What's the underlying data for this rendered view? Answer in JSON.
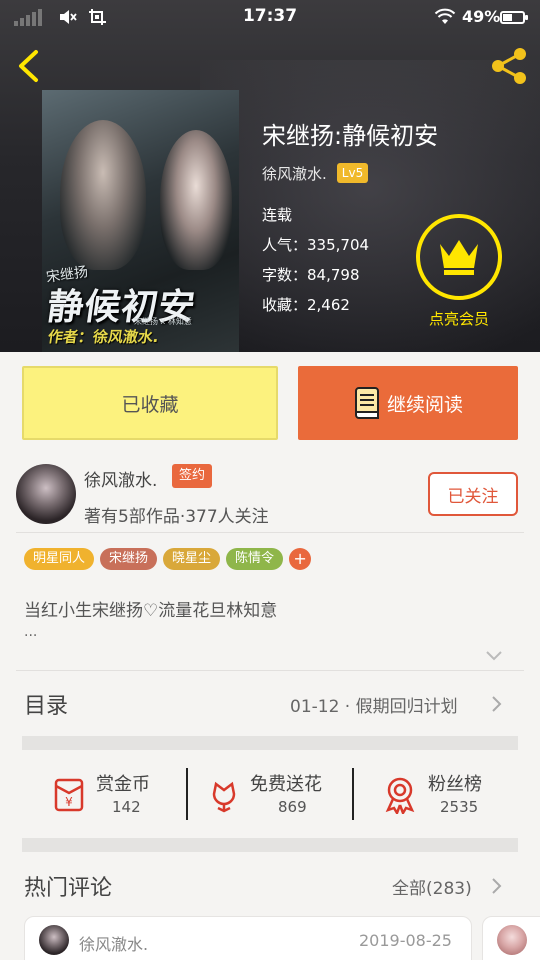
{
  "status_bar": {
    "time": "17:37",
    "battery_pct": "49%",
    "battery_level": 0.49,
    "icons": [
      "signal-icon",
      "mute-icon",
      "screenshot-icon",
      "wifi-icon",
      "battery-icon"
    ]
  },
  "header": {
    "back_icon": "chevron-left-icon",
    "share_icon": "share-icon"
  },
  "cover": {
    "title_art": "静候初安",
    "subtitle_art": "宋继扬",
    "author_art": "作者：徐风澈水.",
    "fine_print": "宋继扬 x 林知意"
  },
  "book": {
    "title": "宋继扬:静候初安",
    "author": "徐风澈水.",
    "author_level": "Lv5",
    "status": "连载",
    "popularity": "人气：335,704",
    "word_count": "字数：84,798",
    "favorites": "收藏：2,462"
  },
  "vip": {
    "icon": "crown-icon",
    "label": "点亮会员"
  },
  "actions": {
    "collected_label": "已收藏",
    "read_label": "继续阅读"
  },
  "author_card": {
    "name": "徐风澈水.",
    "sign_badge": "签约",
    "works": "著有5部作品·377人关注",
    "follow_label": "已关注"
  },
  "tags": [
    {
      "label": "明星同人",
      "color": "#f0b22e"
    },
    {
      "label": "宋继扬",
      "color": "#c8705a"
    },
    {
      "label": "晓星尘",
      "color": "#d9a83a"
    },
    {
      "label": "陈情令",
      "color": "#8fb64a"
    }
  ],
  "tag_add": "+",
  "description": {
    "text": "当红小生宋继扬♡流量花旦林知意",
    "more": "..."
  },
  "catalog": {
    "label": "目录",
    "latest": "01-12 · 假期回归计划"
  },
  "stats": [
    {
      "icon": "red-envelope-icon",
      "label": "赏金币",
      "value": "142"
    },
    {
      "icon": "flower-icon",
      "label": "免费送花",
      "value": "869"
    },
    {
      "icon": "award-ribbon-icon",
      "label": "粉丝榜",
      "value": "2535"
    }
  ],
  "comments": {
    "label": "热门评论",
    "all": "全部(283)",
    "first": {
      "user": "徐风澈水.",
      "date": "2019-08-25"
    }
  },
  "colors": {
    "accent_orange": "#ea6b3a",
    "collected_yellow": "#fcf27e",
    "vip_yellow": "#ffe600",
    "level_gold": "#f0b92b"
  }
}
